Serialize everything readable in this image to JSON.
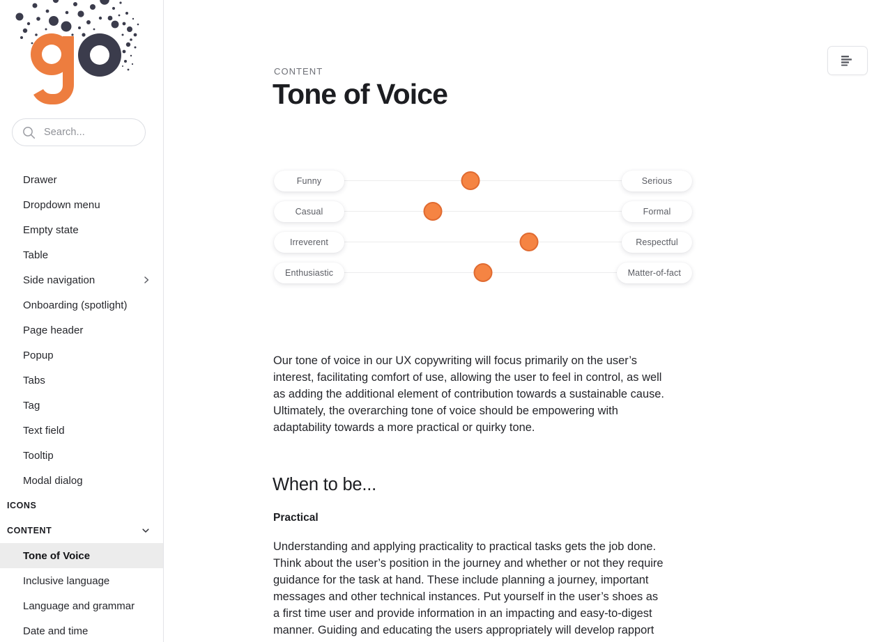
{
  "brand": {
    "logo_text_left": "g",
    "logo_text_right": "o",
    "orange": "#ED7D3F",
    "navy": "#3B3C4C"
  },
  "sidebar": {
    "search": {
      "placeholder": "Search...",
      "value": "",
      "icon": "search-icon"
    },
    "items": [
      {
        "label": "Drawer",
        "icon": null
      },
      {
        "label": "Dropdown menu",
        "icon": null
      },
      {
        "label": "Empty state",
        "icon": null
      },
      {
        "label": "Table",
        "icon": null
      },
      {
        "label": "Side navigation",
        "icon": "chevron-right-icon"
      },
      {
        "label": "Onboarding (spotlight)",
        "icon": null
      },
      {
        "label": "Page header",
        "icon": null
      },
      {
        "label": "Popup",
        "icon": null
      },
      {
        "label": "Tabs",
        "icon": null
      },
      {
        "label": "Tag",
        "icon": null
      },
      {
        "label": "Text field",
        "icon": null
      },
      {
        "label": "Tooltip",
        "icon": null
      },
      {
        "label": "Modal dialog",
        "icon": null
      }
    ],
    "sections": [
      {
        "label": "ICONS",
        "icon": null,
        "expanded": false
      },
      {
        "label": "CONTENT",
        "icon": "chevron-down-icon",
        "expanded": true
      }
    ],
    "content_children": [
      {
        "label": "Tone of Voice",
        "active": true
      },
      {
        "label": "Inclusive language",
        "active": false
      },
      {
        "label": "Language and grammar",
        "active": false
      },
      {
        "label": "Date and time",
        "active": false
      }
    ]
  },
  "header": {
    "eyebrow": "CONTENT",
    "title": "Tone of Voice",
    "toolbar_button_icon": "text-align-left-icon"
  },
  "chart_data": {
    "type": "scatter",
    "title": "",
    "xlabel": "",
    "ylabel": "",
    "xlim": [
      0,
      100
    ],
    "grid": false,
    "legend": "none",
    "description": "Four tone-of-voice spectrum sliders; each handle marks the chosen position between the two extremes.",
    "rows": [
      {
        "left_label": "Funny",
        "right_label": "Serious",
        "value": 47
      },
      {
        "left_label": "Casual",
        "right_label": "Formal",
        "value": 38
      },
      {
        "left_label": "Irreverent",
        "right_label": "Respectful",
        "value": 61
      },
      {
        "left_label": "Enthusiastic",
        "right_label": "Matter-of-fact",
        "value": 50
      }
    ],
    "handle_color": "#F58443",
    "handle_border_color": "#E06A30",
    "track_color": "#ECECED"
  },
  "main": {
    "intro_paragraph": "Our tone of voice in our UX copywriting will focus primarily on the user’s interest, facilitating comfort of use, allowing the user to feel in control, as well as adding the additional element of contribution towards a sustainable cause. Ultimately, the overarching tone of voice should be empowering with adaptability towards a more practical or quirky tone.",
    "section_heading": "When to be...",
    "subsection_heading": "Practical",
    "practical_paragraph": "Understanding and applying practicality to practical tasks gets the job done. Think about the user’s position in the journey and whether or not they require guidance for the task at hand. These include planning a journey, important messages and other technical instances. Put yourself in the user’s shoes as a first time user and provide information in an impacting and easy-to-digest manner. Guiding and educating the users appropriately will develop rapport"
  }
}
